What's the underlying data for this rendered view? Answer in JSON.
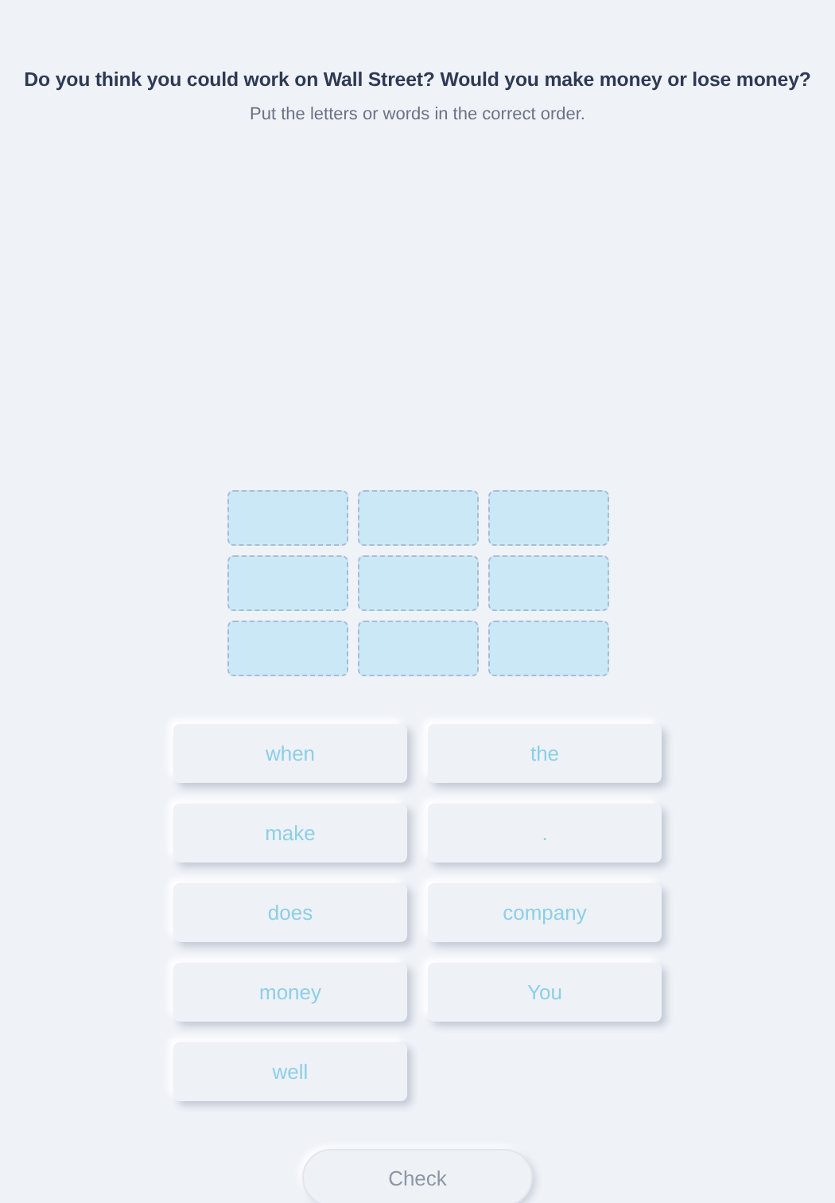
{
  "question": "Do you think you could work on Wall Street? Would you make money or lose money?",
  "instruction": "Put the letters or words in the correct order.",
  "answer_slots": [
    {
      "filled": false
    },
    {
      "filled": false
    },
    {
      "filled": false
    },
    {
      "filled": false
    },
    {
      "filled": false
    },
    {
      "filled": false
    },
    {
      "filled": false
    },
    {
      "filled": false
    },
    {
      "filled": false
    }
  ],
  "word_tiles": [
    {
      "label": "when"
    },
    {
      "label": "the"
    },
    {
      "label": "make"
    },
    {
      "label": "."
    },
    {
      "label": "does"
    },
    {
      "label": "company"
    },
    {
      "label": "money"
    },
    {
      "label": "You"
    },
    {
      "label": "well"
    }
  ],
  "check_button": {
    "label": "Check",
    "disabled": true
  }
}
